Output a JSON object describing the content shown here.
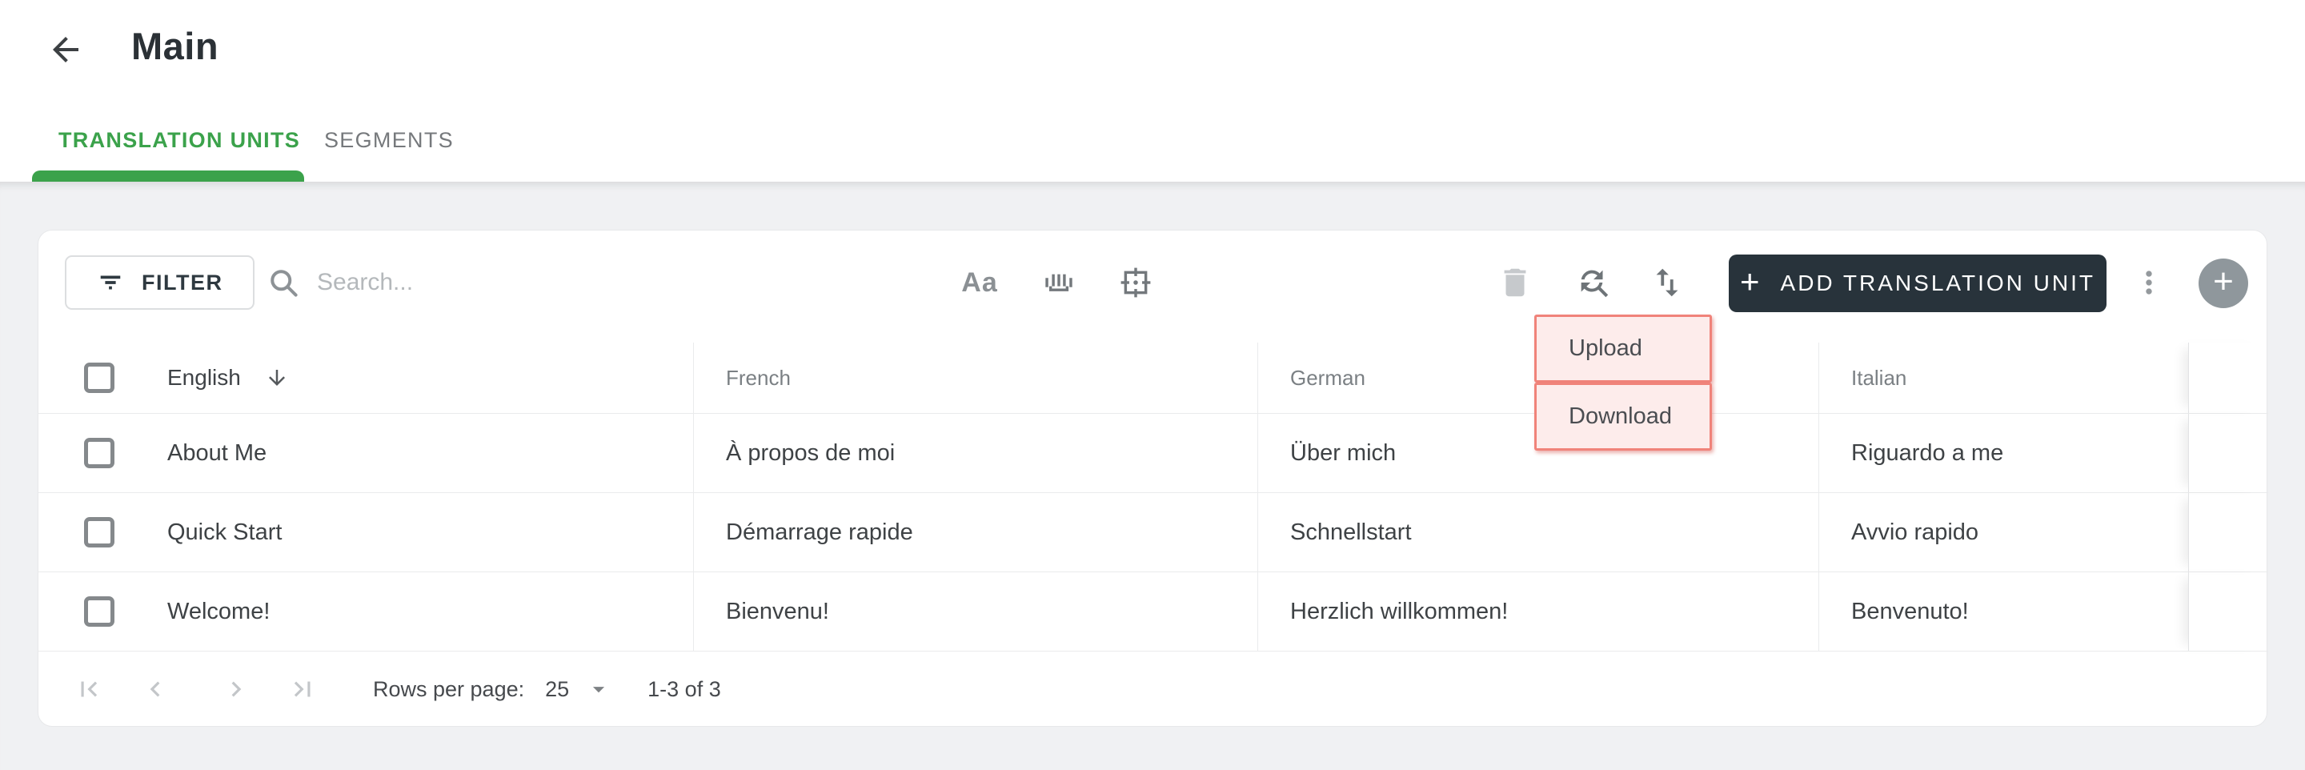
{
  "header": {
    "title": "Main"
  },
  "tabs": {
    "translation_units": "TRANSLATION UNITS",
    "segments": "SEGMENTS"
  },
  "toolbar": {
    "filter_label": "FILTER",
    "search_placeholder": "Search...",
    "match_case_label": "Aa",
    "add_unit_label": "ADD TRANSLATION UNIT",
    "add_unit_plus": "+",
    "fab_plus": "+"
  },
  "menu": {
    "upload": "Upload",
    "download": "Download"
  },
  "table": {
    "headers": {
      "english": "English",
      "french": "French",
      "german": "German",
      "italian": "Italian"
    },
    "sort": {
      "column": "English",
      "direction": "descending"
    },
    "rows": [
      {
        "english": "About Me",
        "french": "À propos de moi",
        "german": "Über mich",
        "italian": "Riguardo a me"
      },
      {
        "english": "Quick Start",
        "french": "Démarrage rapide",
        "german": "Schnellstart",
        "italian": "Avvio rapido"
      },
      {
        "english": "Welcome!",
        "french": "Bienvenu!",
        "german": "Herzlich willkommen!",
        "italian": "Benvenuto!"
      }
    ]
  },
  "footer": {
    "rows_per_page_label": "Rows per page:",
    "rows_per_page_value": "25",
    "range_label": "1-3 of 3"
  },
  "colors": {
    "accent_green": "#3ba24b",
    "dark_button": "#28333b",
    "highlight_border": "#f0837a",
    "highlight_bg": "#fdeceb"
  }
}
